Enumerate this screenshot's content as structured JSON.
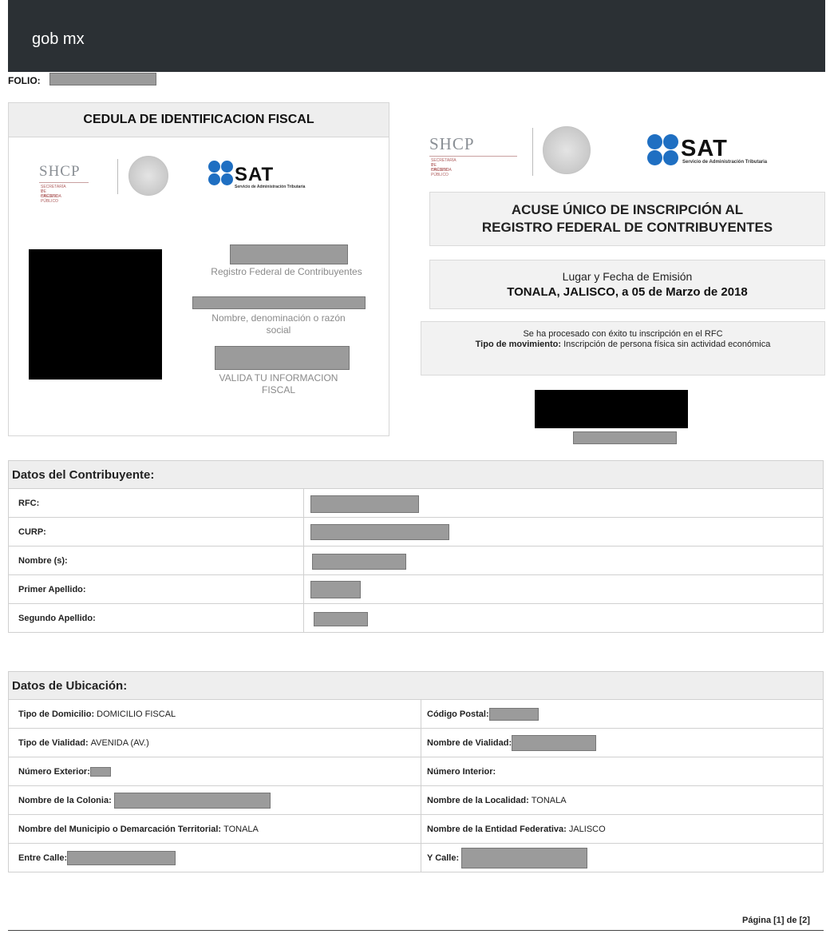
{
  "header": {
    "brand": "gob mx",
    "folio_label": "FOLIO:"
  },
  "cedula": {
    "title": "CEDULA DE IDENTIFICACION FISCAL",
    "rfc_caption": "Registro Federal de Contribuyentes",
    "name_caption": "Nombre, denominación o razón social",
    "valida_caption": "VALIDA TU INFORMACION FISCAL"
  },
  "logos": {
    "shcp": "SHCP",
    "shcp_sub_1": "SECRETARÍA DE HACIENDA",
    "shcp_sub_2": "Y CRÉDITO PÚBLICO",
    "sat": "SAT",
    "sat_sub": "Servicio de Administración Tributaria"
  },
  "acuse": {
    "title_line1": "ACUSE ÚNICO DE INSCRIPCIÓN AL",
    "title_line2": "REGISTRO FEDERAL DE CONTRIBUYENTES",
    "lugar_label": "Lugar y Fecha de Emisión",
    "lugar_value": "TONALA, JALISCO, a 05 de Marzo de 2018",
    "proceso_msg": "Se ha procesado con éxito tu inscripción en el RFC",
    "tipo_label": "Tipo de movimiento:",
    "tipo_value": "Inscripción de persona física sin actividad económica"
  },
  "contribuyente": {
    "heading": "Datos del Contribuyente:",
    "rows": [
      "RFC:",
      "CURP:",
      "Nombre (s):",
      "Primer Apellido:",
      "Segundo Apellido:"
    ]
  },
  "ubicacion": {
    "heading": "Datos de Ubicación:",
    "tipo_domicilio_label": "Tipo de Domicilio:",
    "tipo_domicilio_value": "DOMICILIO FISCAL",
    "codigo_postal_label": "Código Postal:",
    "tipo_vialidad_label": "Tipo de Vialidad:",
    "tipo_vialidad_value": "AVENIDA (AV.)",
    "nombre_vialidad_label": "Nombre de Vialidad:",
    "numero_exterior_label": "Número Exterior:",
    "numero_interior_label": "Número Interior:",
    "colonia_label": "Nombre de la Colonia:",
    "localidad_label": "Nombre de la Localidad:",
    "localidad_value": "TONALA",
    "municipio_label": "Nombre del Municipio o Demarcación Territorial:",
    "municipio_value": "TONALA",
    "entidad_label": "Nombre de la Entidad Federativa:",
    "entidad_value": "JALISCO",
    "entre_calle_label": "Entre Calle:",
    "y_calle_label": "Y Calle:"
  },
  "footer": {
    "page": "Página [1] de [2]"
  }
}
